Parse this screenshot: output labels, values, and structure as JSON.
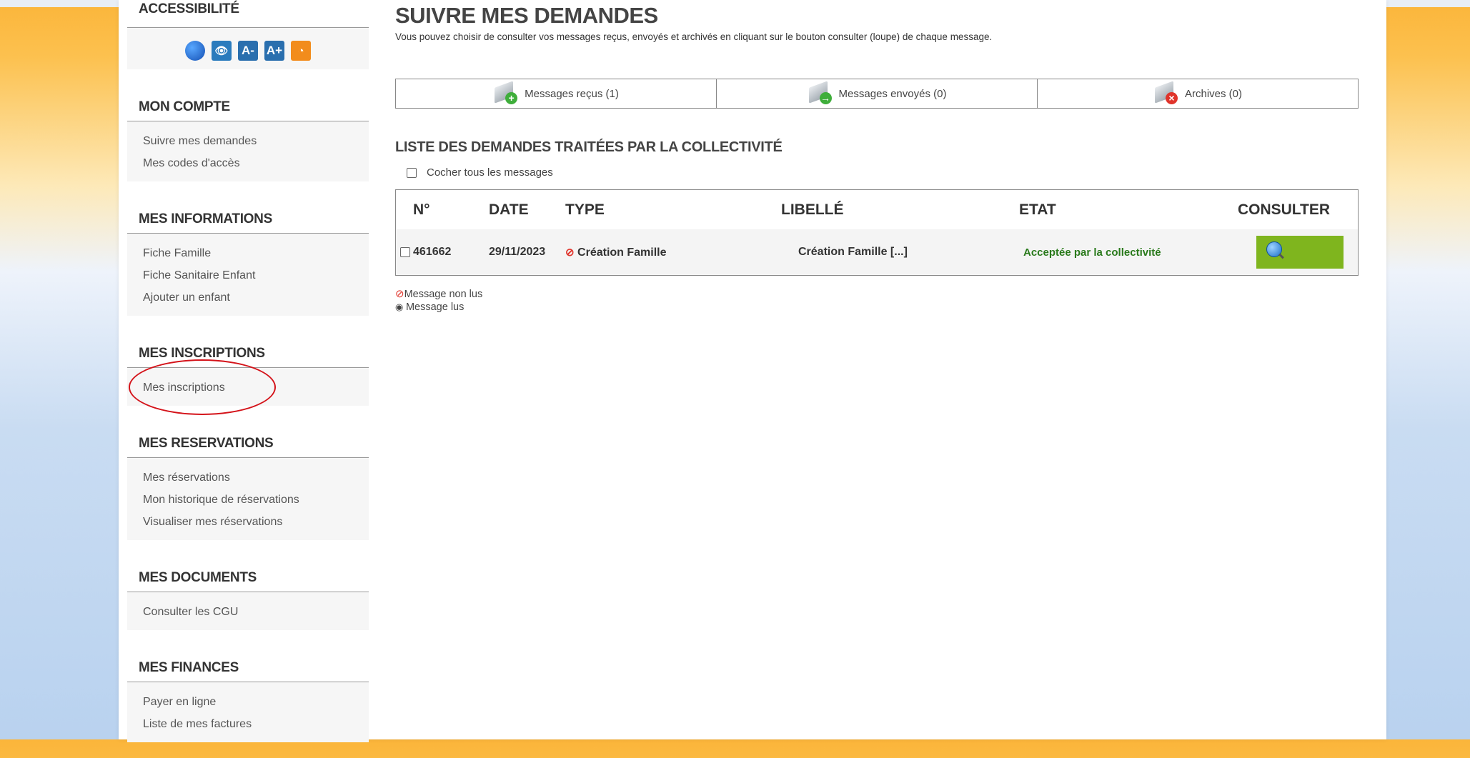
{
  "sidebar": {
    "accessibility": {
      "title": "ACCESSIBILITÉ",
      "icons": [
        "globe-icon",
        "eye-icon",
        "font-decrease-icon",
        "font-increase-icon",
        "rss-icon"
      ],
      "font_decrease": "A-",
      "font_increase": "A+"
    },
    "mon_compte": {
      "title": "MON COMPTE",
      "items": [
        "Suivre mes demandes",
        "Mes codes d'accès"
      ]
    },
    "mes_informations": {
      "title": "MES INFORMATIONS",
      "items": [
        "Fiche Famille",
        "Fiche Sanitaire Enfant",
        "Ajouter un enfant"
      ]
    },
    "mes_inscriptions": {
      "title": "MES INSCRIPTIONS",
      "items": [
        "Mes inscriptions"
      ]
    },
    "mes_reservations": {
      "title": "MES RESERVATIONS",
      "items": [
        "Mes réservations",
        "Mon historique de réservations",
        "Visualiser mes réservations"
      ]
    },
    "mes_documents": {
      "title": "MES DOCUMENTS",
      "items": [
        "Consulter les CGU"
      ]
    },
    "mes_finances": {
      "title": "MES FINANCES",
      "items": [
        "Payer en ligne",
        "Liste de mes factures"
      ]
    }
  },
  "main": {
    "title": "SUIVRE MES DEMANDES",
    "description": "Vous pouvez choisir de consulter vos messages reçus, envoyés et archivés en cliquant sur le bouton consulter (loupe) de chaque message.",
    "tabs": [
      {
        "label": "Messages reçus  (1)"
      },
      {
        "label": "Messages envoyés (0)"
      },
      {
        "label": "Archives (0)"
      }
    ],
    "list_title": "LISTE DES DEMANDES TRAITÉES PAR LA COLLECTIVITÉ",
    "check_all_label": "Cocher tous les messages",
    "table": {
      "headers": [
        "N°",
        "DATE",
        "TYPE",
        "LIBELLÉ",
        "ETAT",
        "CONSULTER"
      ],
      "rows": [
        {
          "num": "461662",
          "date": "29/11/2023",
          "type": "Création Famille",
          "libelle": "Création Famille   [...]",
          "etat": "Acceptée par la collectivité"
        }
      ]
    },
    "legend": {
      "unread": "Message non lus",
      "read": "Message lus"
    }
  },
  "colors": {
    "accent_green": "#7fb51e",
    "status_green": "#2a7a1c",
    "unread_red": "#e0342b"
  }
}
